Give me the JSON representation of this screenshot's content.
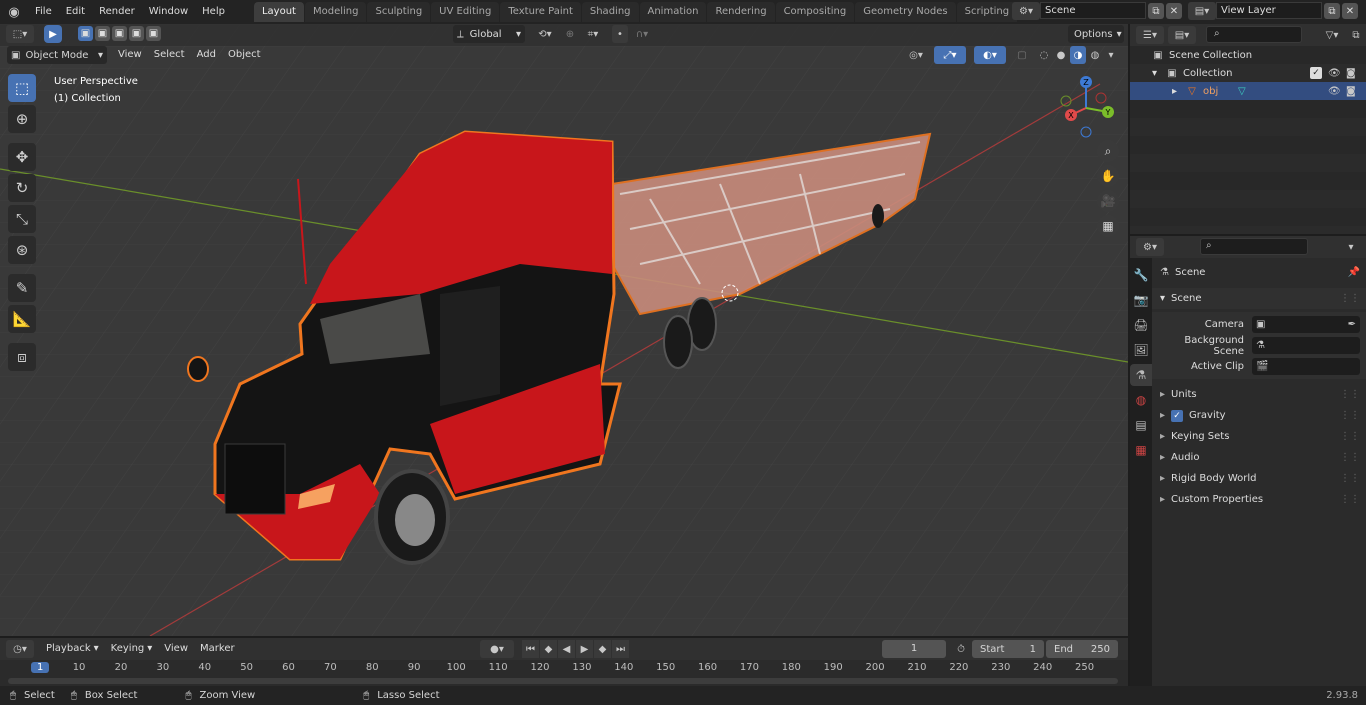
{
  "menus": [
    "File",
    "Edit",
    "Render",
    "Window",
    "Help"
  ],
  "workspaces": [
    "Layout",
    "Modeling",
    "Sculpting",
    "UV Editing",
    "Texture Paint",
    "Shading",
    "Animation",
    "Rendering",
    "Compositing",
    "Geometry Nodes",
    "Scripting"
  ],
  "scene_field": "Scene",
  "view_layer_field": "View Layer",
  "viewport": {
    "mode": "Object Mode",
    "menus": [
      "View",
      "Select",
      "Add",
      "Object"
    ],
    "transform_orientation": "Global",
    "options": "Options",
    "overlay_title": "User Perspective",
    "overlay_subtitle": "(1) Collection",
    "gizmo": {
      "x": "X",
      "y": "Y",
      "z": "Z"
    }
  },
  "outliner": {
    "scene_collection": "Scene Collection",
    "collection": "Collection",
    "object": "obj"
  },
  "properties": {
    "header": "Scene",
    "panel": "Scene",
    "fields": [
      {
        "label": "Camera"
      },
      {
        "label": "Background Scene"
      },
      {
        "label": "Active Clip"
      }
    ],
    "sections": [
      {
        "label": "Units"
      },
      {
        "label": "Gravity",
        "checked": true
      },
      {
        "label": "Keying Sets"
      },
      {
        "label": "Audio"
      },
      {
        "label": "Rigid Body World"
      },
      {
        "label": "Custom Properties"
      }
    ]
  },
  "timeline": {
    "menus": [
      "Playback",
      "Keying",
      "View",
      "Marker"
    ],
    "current_frame": "1",
    "start_label": "Start",
    "start": "1",
    "end_label": "End",
    "end": "250",
    "ticks": [
      "1",
      "10",
      "20",
      "30",
      "40",
      "50",
      "60",
      "70",
      "80",
      "90",
      "100",
      "110",
      "120",
      "130",
      "140",
      "150",
      "160",
      "170",
      "180",
      "190",
      "200",
      "210",
      "220",
      "230",
      "240",
      "250"
    ]
  },
  "status": {
    "select": "Select",
    "box_select": "Box Select",
    "zoom_view": "Zoom View",
    "lasso_select": "Lasso Select",
    "version": "2.93.8"
  },
  "colors": {
    "accent": "#4772b3",
    "selection_outline": "#f0761f",
    "truck_red": "#c8161b",
    "truck_black": "#141414"
  }
}
